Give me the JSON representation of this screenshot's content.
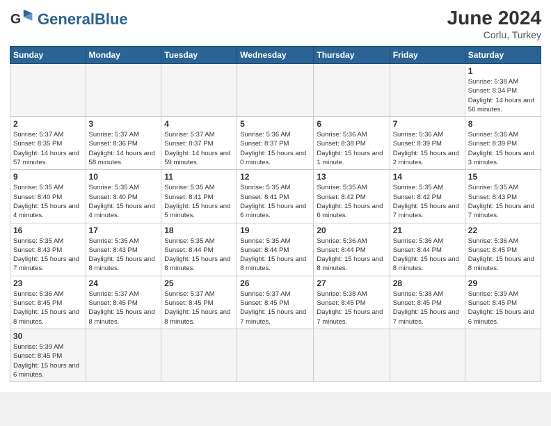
{
  "header": {
    "logo_general": "General",
    "logo_blue": "Blue",
    "month_year": "June 2024",
    "location": "Corlu, Turkey"
  },
  "weekdays": [
    "Sunday",
    "Monday",
    "Tuesday",
    "Wednesday",
    "Thursday",
    "Friday",
    "Saturday"
  ],
  "weeks": [
    [
      {
        "day": "",
        "info": ""
      },
      {
        "day": "",
        "info": ""
      },
      {
        "day": "",
        "info": ""
      },
      {
        "day": "",
        "info": ""
      },
      {
        "day": "",
        "info": ""
      },
      {
        "day": "",
        "info": ""
      },
      {
        "day": "1",
        "info": "Sunrise: 5:38 AM\nSunset: 8:34 PM\nDaylight: 14 hours and 56 minutes."
      }
    ],
    [
      {
        "day": "2",
        "info": "Sunrise: 5:37 AM\nSunset: 8:35 PM\nDaylight: 14 hours and 57 minutes."
      },
      {
        "day": "3",
        "info": "Sunrise: 5:37 AM\nSunset: 8:36 PM\nDaylight: 14 hours and 58 minutes."
      },
      {
        "day": "4",
        "info": "Sunrise: 5:37 AM\nSunset: 8:37 PM\nDaylight: 14 hours and 59 minutes."
      },
      {
        "day": "5",
        "info": "Sunrise: 5:36 AM\nSunset: 8:37 PM\nDaylight: 15 hours and 0 minutes."
      },
      {
        "day": "6",
        "info": "Sunrise: 5:36 AM\nSunset: 8:38 PM\nDaylight: 15 hours and 1 minute."
      },
      {
        "day": "7",
        "info": "Sunrise: 5:36 AM\nSunset: 8:39 PM\nDaylight: 15 hours and 2 minutes."
      },
      {
        "day": "8",
        "info": "Sunrise: 5:36 AM\nSunset: 8:39 PM\nDaylight: 15 hours and 3 minutes."
      }
    ],
    [
      {
        "day": "9",
        "info": "Sunrise: 5:35 AM\nSunset: 8:40 PM\nDaylight: 15 hours and 4 minutes."
      },
      {
        "day": "10",
        "info": "Sunrise: 5:35 AM\nSunset: 8:40 PM\nDaylight: 15 hours and 4 minutes."
      },
      {
        "day": "11",
        "info": "Sunrise: 5:35 AM\nSunset: 8:41 PM\nDaylight: 15 hours and 5 minutes."
      },
      {
        "day": "12",
        "info": "Sunrise: 5:35 AM\nSunset: 8:41 PM\nDaylight: 15 hours and 6 minutes."
      },
      {
        "day": "13",
        "info": "Sunrise: 5:35 AM\nSunset: 8:42 PM\nDaylight: 15 hours and 6 minutes."
      },
      {
        "day": "14",
        "info": "Sunrise: 5:35 AM\nSunset: 8:42 PM\nDaylight: 15 hours and 7 minutes."
      },
      {
        "day": "15",
        "info": "Sunrise: 5:35 AM\nSunset: 8:43 PM\nDaylight: 15 hours and 7 minutes."
      }
    ],
    [
      {
        "day": "16",
        "info": "Sunrise: 5:35 AM\nSunset: 8:43 PM\nDaylight: 15 hours and 7 minutes."
      },
      {
        "day": "17",
        "info": "Sunrise: 5:35 AM\nSunset: 8:43 PM\nDaylight: 15 hours and 8 minutes."
      },
      {
        "day": "18",
        "info": "Sunrise: 5:35 AM\nSunset: 8:44 PM\nDaylight: 15 hours and 8 minutes."
      },
      {
        "day": "19",
        "info": "Sunrise: 5:35 AM\nSunset: 8:44 PM\nDaylight: 15 hours and 8 minutes."
      },
      {
        "day": "20",
        "info": "Sunrise: 5:36 AM\nSunset: 8:44 PM\nDaylight: 15 hours and 8 minutes."
      },
      {
        "day": "21",
        "info": "Sunrise: 5:36 AM\nSunset: 8:44 PM\nDaylight: 15 hours and 8 minutes."
      },
      {
        "day": "22",
        "info": "Sunrise: 5:36 AM\nSunset: 8:45 PM\nDaylight: 15 hours and 8 minutes."
      }
    ],
    [
      {
        "day": "23",
        "info": "Sunrise: 5:36 AM\nSunset: 8:45 PM\nDaylight: 15 hours and 8 minutes."
      },
      {
        "day": "24",
        "info": "Sunrise: 5:37 AM\nSunset: 8:45 PM\nDaylight: 15 hours and 8 minutes."
      },
      {
        "day": "25",
        "info": "Sunrise: 5:37 AM\nSunset: 8:45 PM\nDaylight: 15 hours and 8 minutes."
      },
      {
        "day": "26",
        "info": "Sunrise: 5:37 AM\nSunset: 8:45 PM\nDaylight: 15 hours and 7 minutes."
      },
      {
        "day": "27",
        "info": "Sunrise: 5:38 AM\nSunset: 8:45 PM\nDaylight: 15 hours and 7 minutes."
      },
      {
        "day": "28",
        "info": "Sunrise: 5:38 AM\nSunset: 8:45 PM\nDaylight: 15 hours and 7 minutes."
      },
      {
        "day": "29",
        "info": "Sunrise: 5:39 AM\nSunset: 8:45 PM\nDaylight: 15 hours and 6 minutes."
      }
    ],
    [
      {
        "day": "30",
        "info": "Sunrise: 5:39 AM\nSunset: 8:45 PM\nDaylight: 15 hours and 6 minutes."
      },
      {
        "day": "",
        "info": ""
      },
      {
        "day": "",
        "info": ""
      },
      {
        "day": "",
        "info": ""
      },
      {
        "day": "",
        "info": ""
      },
      {
        "day": "",
        "info": ""
      },
      {
        "day": "",
        "info": ""
      }
    ]
  ]
}
